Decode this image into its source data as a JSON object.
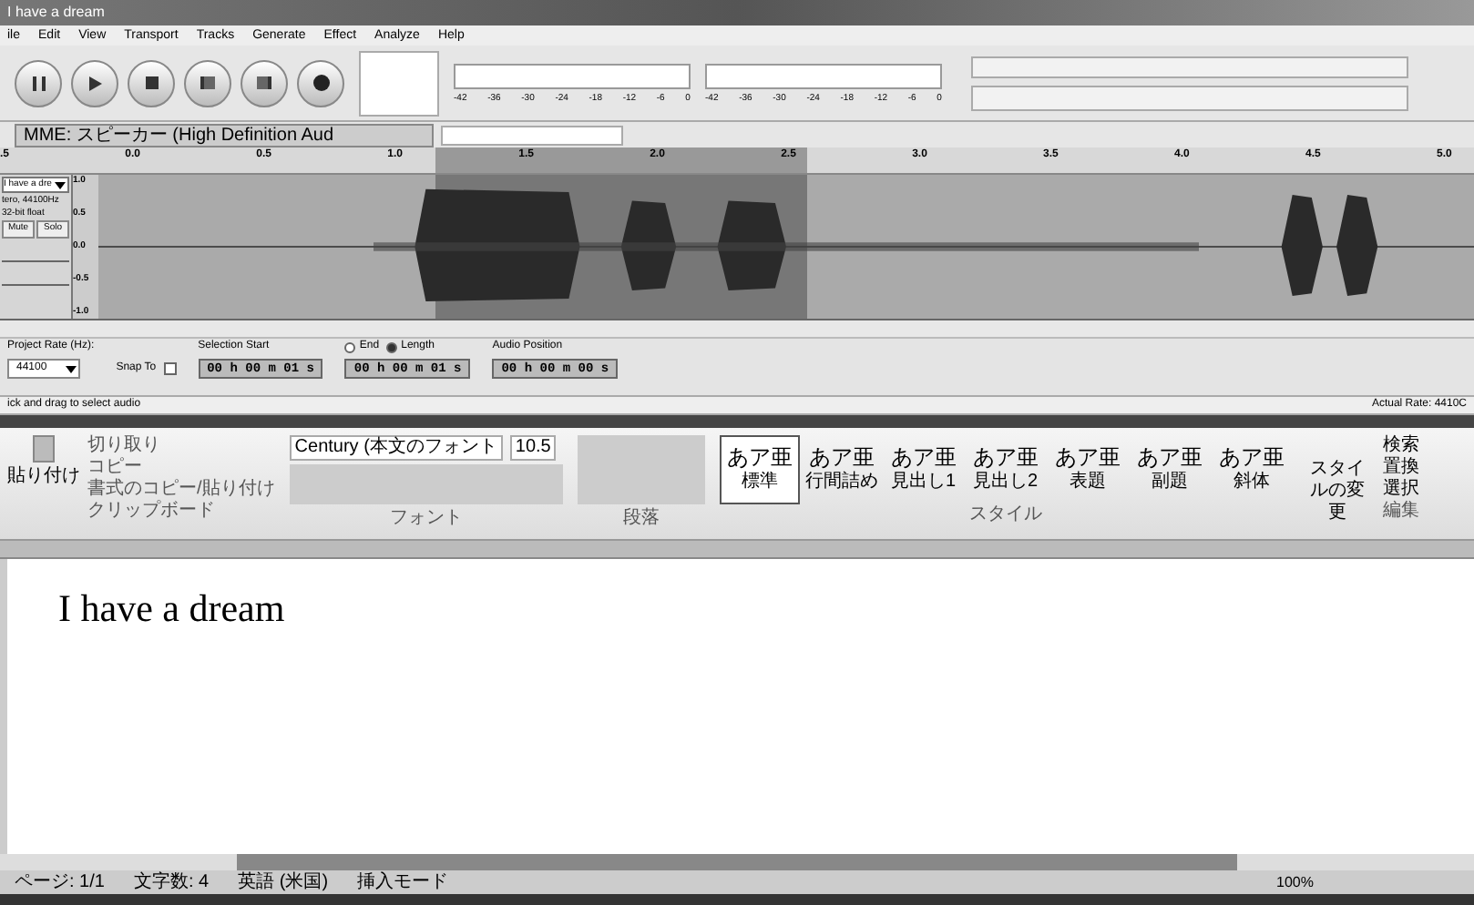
{
  "audacity": {
    "title": "I have a dream",
    "menu": [
      "ile",
      "Edit",
      "View",
      "Transport",
      "Tracks",
      "Generate",
      "Effect",
      "Analyze",
      "Help"
    ],
    "playback_meter_ticks": [
      "-42",
      "-36",
      "-30",
      "-24",
      "-18",
      "-12",
      "-6",
      "0"
    ],
    "record_meter_ticks": [
      "-42",
      "-36",
      "-30",
      "-24",
      "-18",
      "-12",
      "-6",
      "0"
    ],
    "device": "MME: スピーカー (High Definition Aud",
    "ruler": [
      ".5",
      "0.0",
      "0.5",
      "1.0",
      "1.5",
      "2.0",
      "2.5",
      "3.0",
      "3.5",
      "4.0",
      "4.5",
      "5.0"
    ],
    "track": {
      "name": "I have a dre",
      "info": [
        "tero, 44100Hz",
        "32-bit float"
      ],
      "mute": "Mute",
      "solo": "Solo",
      "scale": [
        "1.0",
        "0.5",
        "0.0",
        "-0.5",
        "-1.0"
      ]
    },
    "selection_bar": {
      "rate_label": "Project Rate (Hz):",
      "rate": "44100",
      "snap_label": "Snap To",
      "snap": false,
      "start_label": "Selection Start",
      "radios": [
        {
          "label": "End",
          "selected": false
        },
        {
          "label": "Length",
          "selected": true
        }
      ],
      "position_label": "Audio Position",
      "times": [
        "00 h 00 m 01 s",
        "00 h 00 m 01 s",
        "00 h 00 m 00 s"
      ]
    },
    "status": "ick and drag to select audio",
    "actual_rate": "Actual Rate: 4410C"
  },
  "word": {
    "clipboard": {
      "paste": "貼り付け",
      "items": [
        "切り取り",
        "コピー",
        "書式のコピー/貼り付け"
      ],
      "group": "クリップボード"
    },
    "font": {
      "name": "Century (本文のフォント",
      "size": "10.5",
      "group": "フォント"
    },
    "paragraph": {
      "group": "段落"
    },
    "styles": [
      {
        "sample": "あア亜",
        "label": "標準",
        "selected": true
      },
      {
        "sample": "あア亜",
        "label": "行間詰め",
        "selected": false
      },
      {
        "sample": "あア亜",
        "label": "見出し1",
        "selected": false
      },
      {
        "sample": "あア亜",
        "label": "見出し2",
        "selected": false
      },
      {
        "sample": "あア亜",
        "label": "表題",
        "selected": false
      },
      {
        "sample": "あア亜",
        "label": "副題",
        "selected": false
      },
      {
        "sample": "あア亜",
        "label": "斜体",
        "selected": false
      }
    ],
    "styles_group": "スタイル",
    "change_styles": "スタイルの変更",
    "editing": {
      "items": [
        "検索",
        "置換",
        "選択"
      ],
      "group": "編集"
    },
    "document_text": "I have a dream",
    "status": [
      "ページ: 1/1",
      "文字数: 4",
      "英語 (米国)",
      "挿入モード"
    ],
    "zoom": "100%"
  }
}
